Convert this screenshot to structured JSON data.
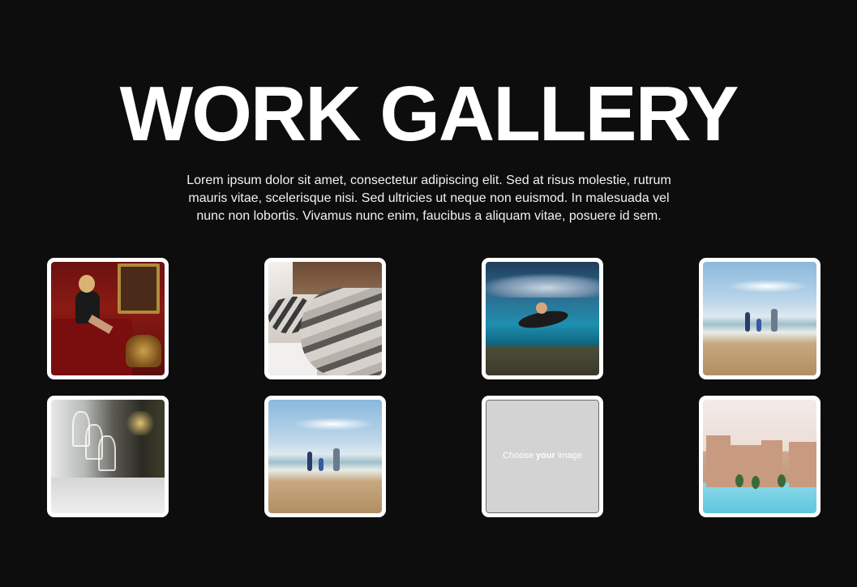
{
  "header": {
    "title": "WORK GALLERY",
    "description": "Lorem ipsum dolor sit amet, consectetur adipiscing elit. Sed at risus molestie, rutrum mauris vitae, scelerisque nisi. Sed ultricies ut neque non euismod. In malesuada vel nunc non lobortis. Vivamus nunc enim, faucibus a aliquam vitae, posuere id sem."
  },
  "gallery": {
    "placeholder": {
      "prefix": "Choose ",
      "emphasis": "your",
      "suffix": " image"
    }
  },
  "colors": {
    "background": "#0d0d0d",
    "title": "#ffffff",
    "tile_border": "#ffffff",
    "placeholder_bg": "#d3d3d3"
  }
}
